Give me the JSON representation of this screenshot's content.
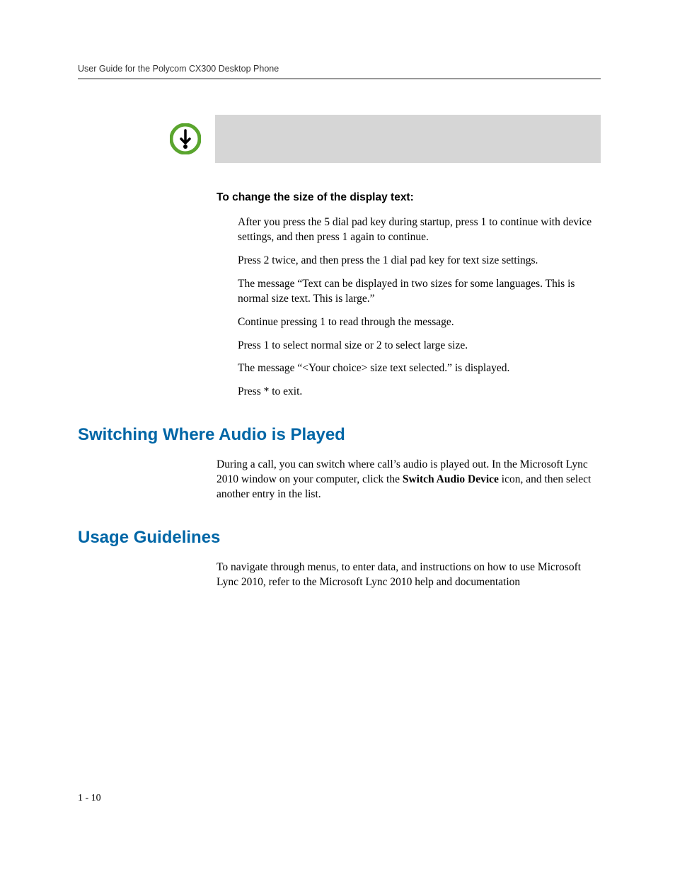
{
  "header": {
    "title": "User Guide for the Polycom CX300 Desktop Phone"
  },
  "procedure": {
    "title": "To change the size of the display text:",
    "steps": [
      "After you press the 5 dial pad key during startup, press 1 to continue with device settings, and then press 1 again to continue.",
      "Press 2 twice, and then press the 1 dial pad key for text size settings.",
      "The message “Text can be displayed in two sizes for some languages. This is normal size text. This is large.”",
      "Continue pressing 1 to read through the message.",
      "Press 1 to select normal size or 2 to select large size.",
      "The message “<Your choice> size text selected.” is displayed.",
      "Press * to exit."
    ]
  },
  "sections": [
    {
      "heading": "Switching Where Audio is Played",
      "body_pre": "During a call, you can switch where call’s audio is played out. In the Microsoft Lync 2010 window on your computer, click the ",
      "body_bold": "Switch Audio Device",
      "body_post": " icon, and then select another entry in the list."
    },
    {
      "heading": "Usage Guidelines",
      "body_pre": "To navigate through menus, to enter data, and instructions on how to use Microsoft Lync 2010, refer to the Microsoft Lync 2010 help and documentation",
      "body_bold": "",
      "body_post": ""
    }
  ],
  "page_number": "1 - 10"
}
